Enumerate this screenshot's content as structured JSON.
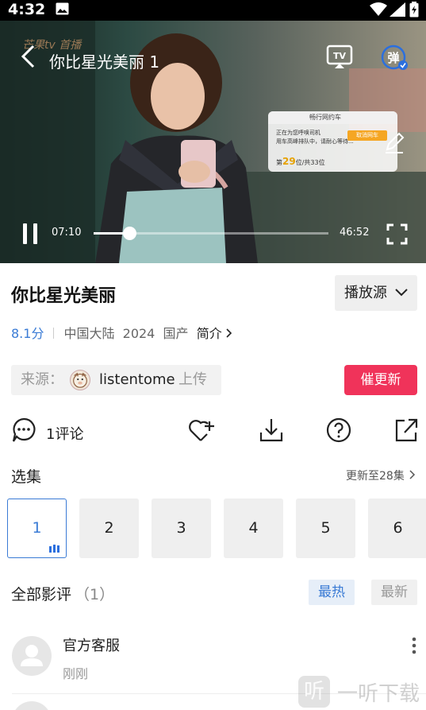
{
  "status_bar": {
    "time": "4:32"
  },
  "player": {
    "watermark": "芒果tv 首播",
    "episode_title": "你比星光美丽 1",
    "current_time": "07:10",
    "duration": "46:52",
    "progress_fraction": 0.153,
    "ad": {
      "brand": "畅行网约车",
      "line1": "正在为您呼唤司机",
      "line2": "用车高峰排队中，请耐心等待...",
      "queue_prefix": "第",
      "queue_number": "29",
      "queue_suffix": "位/共33位",
      "button": "取消网车"
    }
  },
  "show": {
    "title": "你比星光美丽",
    "source_button": "播放源",
    "score": "8.1分",
    "region": "中国大陆",
    "year": "2024",
    "category": "国产",
    "brief_link": "简介"
  },
  "uploader": {
    "label": "来源：",
    "name": "listentome",
    "suffix": "上传"
  },
  "urge_button": "催更新",
  "actions": {
    "comment_count": "1评论"
  },
  "episodes": {
    "heading": "选集",
    "update_info": "更新至28集",
    "items": [
      "1",
      "2",
      "3",
      "4",
      "5",
      "6"
    ],
    "active_index": 0
  },
  "reviews": {
    "heading": "全部影评",
    "count": "（1）",
    "sort_hot": "最热",
    "sort_new": "最新",
    "items": [
      {
        "author": "官方客服",
        "time": "刚刚"
      }
    ]
  },
  "site_watermark": {
    "glyph": "听",
    "text": "一听下载"
  },
  "colors": {
    "accent": "#3a7bd5",
    "urge": "#f0335a"
  }
}
